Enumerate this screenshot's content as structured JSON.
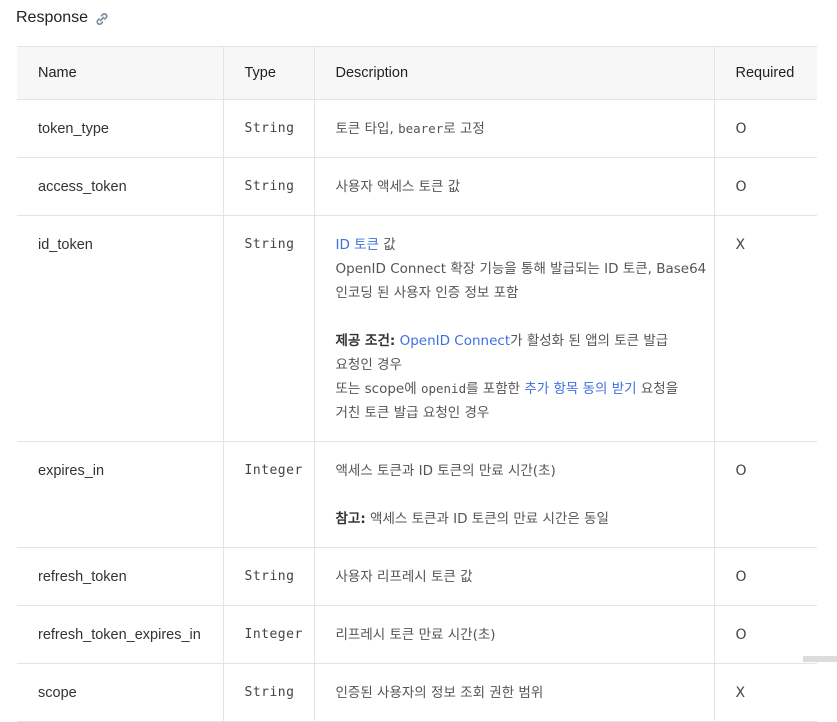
{
  "section": {
    "title": "Response",
    "icon": "link-icon"
  },
  "table": {
    "headers": [
      "Name",
      "Type",
      "Description",
      "Required"
    ],
    "rows": [
      {
        "name": "token_type",
        "type": "String",
        "desc_a": "토큰 타입, ",
        "desc_code": "bearer",
        "desc_b": "로 고정",
        "required": "O"
      },
      {
        "name": "access_token",
        "type": "String",
        "desc": "사용자 액세스 토큰 값",
        "required": "O"
      },
      {
        "name": "id_token",
        "type": "String",
        "desc_link1": "ID 토큰",
        "desc_l1_after": " 값",
        "desc_l2": "OpenID Connect 확장 기능을 통해 발급되는 ID 토큰, Base64",
        "desc_l3": "인코딩 된 사용자 인증 정보 포함",
        "cond_label": "제공 조건:",
        "cond_link": "OpenID Connect",
        "cond_after": "가 활성화 된 앱의 토큰 발급",
        "cond_l2": "요청인 경우",
        "cond_l3_a": "또는 scope에 ",
        "cond_l3_code": "openid",
        "cond_l3_b": "를 포함한 ",
        "cond_l3_link": "추가 항목 동의 받기",
        "cond_l3_c": " 요청을",
        "cond_l4": "거친 토큰 발급 요청인 경우",
        "required": "X"
      },
      {
        "name": "expires_in",
        "type": "Integer",
        "desc": "액세스 토큰과 ID 토큰의 만료 시간(초)",
        "note_label": "참고:",
        "note": " 액세스 토큰과 ID 토큰의 만료 시간은 동일",
        "required": "O"
      },
      {
        "name": "refresh_token",
        "type": "String",
        "desc": "사용자 리프레시 토큰 값",
        "required": "O"
      },
      {
        "name": "refresh_token_expires_in",
        "type": "Integer",
        "desc": "리프레시 토큰 만료 시간(초)",
        "required": "O"
      },
      {
        "name": "scope",
        "type": "String",
        "desc": "인증된 사용자의 정보 조회 권한 범위",
        "required": "X"
      }
    ]
  }
}
